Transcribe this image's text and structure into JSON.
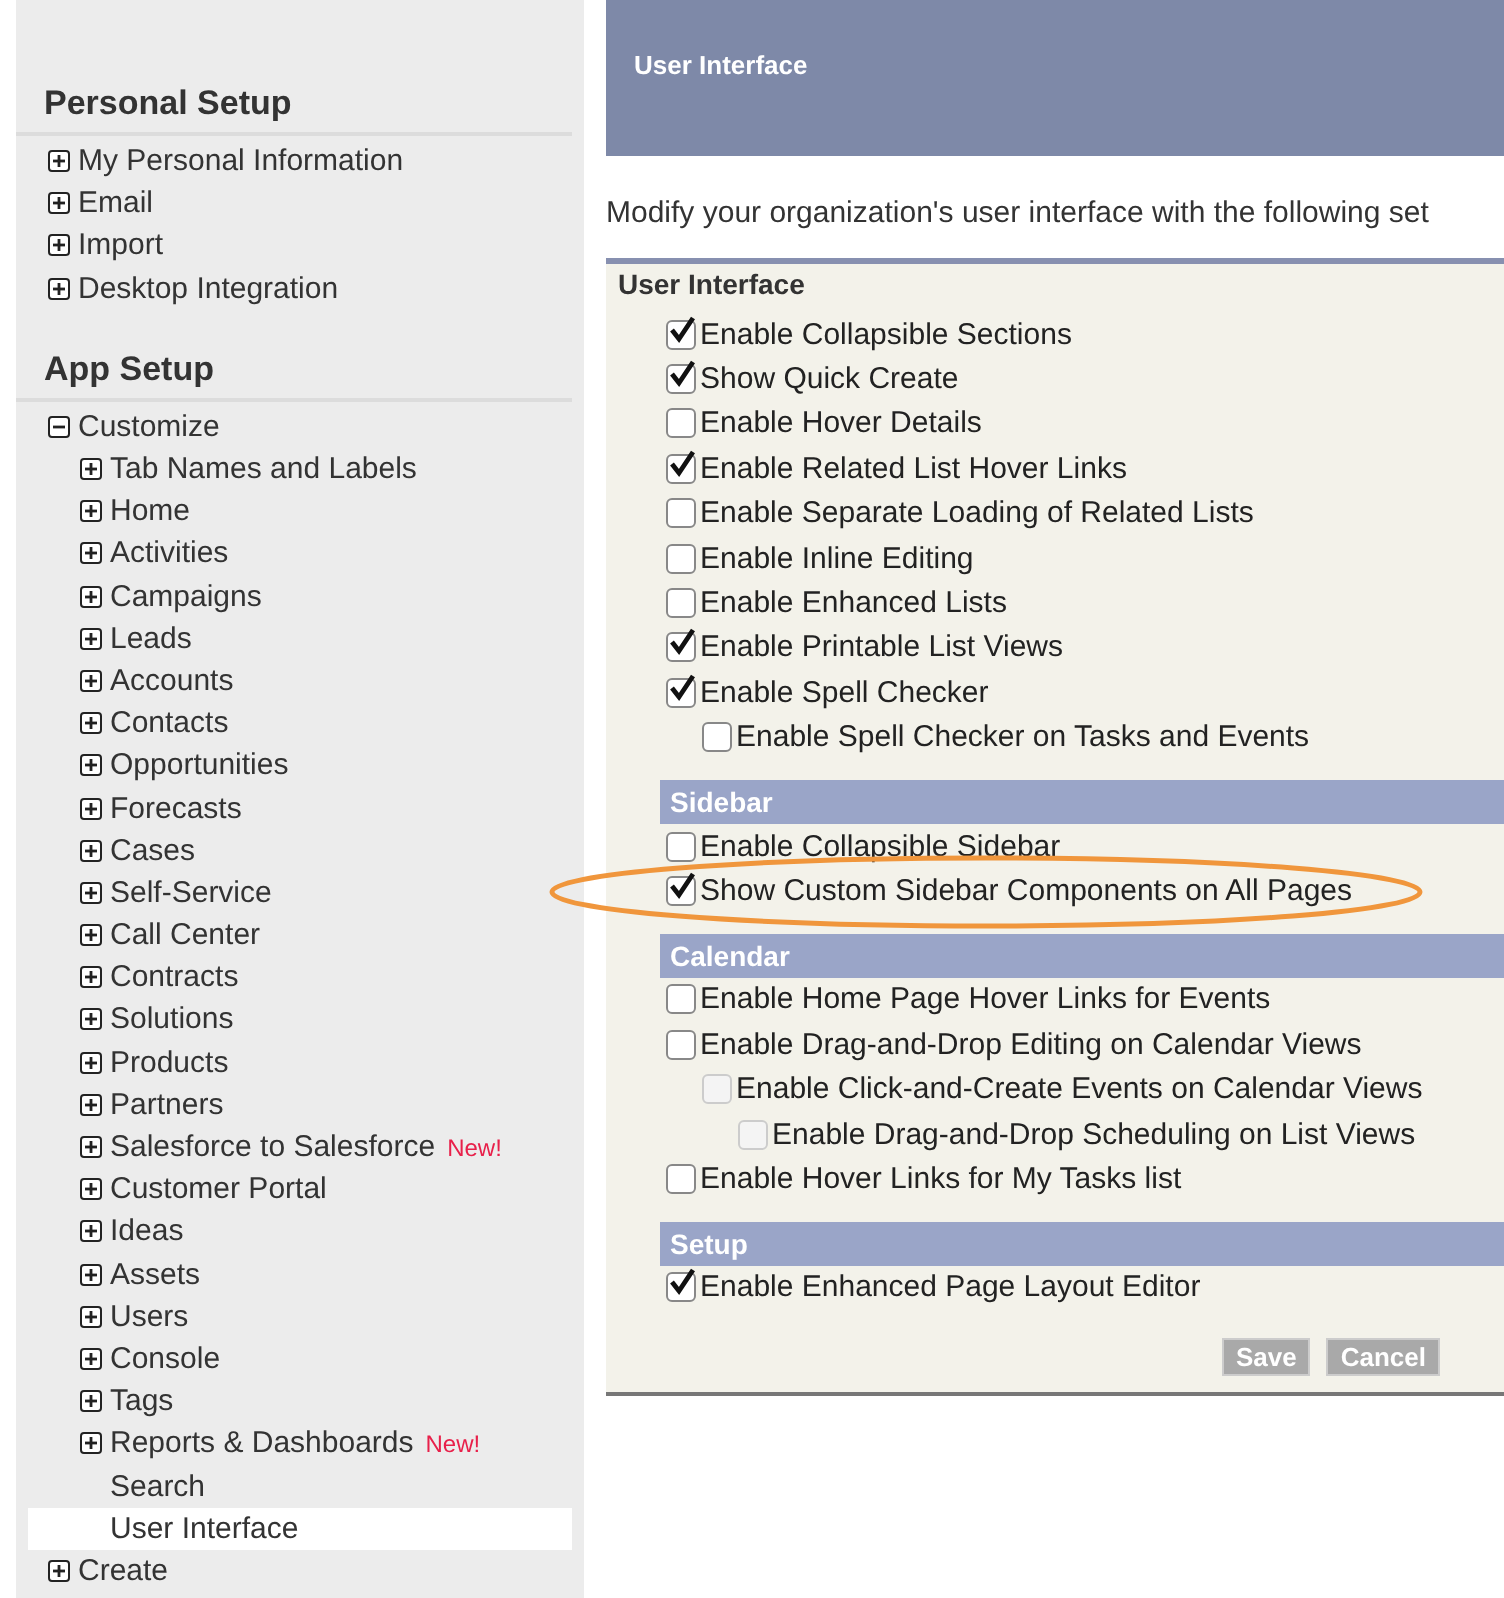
{
  "sidebar": {
    "sections": [
      {
        "title": "Personal Setup",
        "items": [
          {
            "label": "My Personal Information",
            "kind": "folder",
            "expanded": false,
            "selected": false
          },
          {
            "label": "Email",
            "kind": "folder",
            "expanded": false,
            "selected": false
          },
          {
            "label": "Import",
            "kind": "folder",
            "expanded": false,
            "selected": false
          },
          {
            "label": "Desktop Integration",
            "kind": "folder",
            "expanded": false,
            "selected": false
          }
        ]
      },
      {
        "title": "App Setup",
        "items": [
          {
            "label": "Customize",
            "kind": "folder",
            "expanded": true,
            "selected": false,
            "children": [
              {
                "label": "Tab Names and Labels",
                "kind": "folder",
                "expanded": false,
                "selected": false
              },
              {
                "label": "Home",
                "kind": "folder",
                "expanded": false,
                "selected": false
              },
              {
                "label": "Activities",
                "kind": "folder",
                "expanded": false,
                "selected": false
              },
              {
                "label": "Campaigns",
                "kind": "folder",
                "expanded": false,
                "selected": false
              },
              {
                "label": "Leads",
                "kind": "folder",
                "expanded": false,
                "selected": false
              },
              {
                "label": "Accounts",
                "kind": "folder",
                "expanded": false,
                "selected": false
              },
              {
                "label": "Contacts",
                "kind": "folder",
                "expanded": false,
                "selected": false
              },
              {
                "label": "Opportunities",
                "kind": "folder",
                "expanded": false,
                "selected": false
              },
              {
                "label": "Forecasts",
                "kind": "folder",
                "expanded": false,
                "selected": false
              },
              {
                "label": "Cases",
                "kind": "folder",
                "expanded": false,
                "selected": false
              },
              {
                "label": "Self-Service",
                "kind": "folder",
                "expanded": false,
                "selected": false
              },
              {
                "label": "Call Center",
                "kind": "folder",
                "expanded": false,
                "selected": false
              },
              {
                "label": "Contracts",
                "kind": "folder",
                "expanded": false,
                "selected": false
              },
              {
                "label": "Solutions",
                "kind": "folder",
                "expanded": false,
                "selected": false
              },
              {
                "label": "Products",
                "kind": "folder",
                "expanded": false,
                "selected": false
              },
              {
                "label": "Partners",
                "kind": "folder",
                "expanded": false,
                "selected": false
              },
              {
                "label": "Salesforce to Salesforce",
                "badge": "New!",
                "kind": "folder",
                "expanded": false,
                "selected": false
              },
              {
                "label": "Customer Portal",
                "kind": "folder",
                "expanded": false,
                "selected": false
              },
              {
                "label": "Ideas",
                "kind": "folder",
                "expanded": false,
                "selected": false
              },
              {
                "label": "Assets",
                "kind": "folder",
                "expanded": false,
                "selected": false
              },
              {
                "label": "Users",
                "kind": "folder",
                "expanded": false,
                "selected": false
              },
              {
                "label": "Console",
                "kind": "folder",
                "expanded": false,
                "selected": false
              },
              {
                "label": "Tags",
                "kind": "folder",
                "expanded": false,
                "selected": false
              },
              {
                "label": "Reports & Dashboards",
                "badge": "New!",
                "kind": "folder",
                "expanded": false,
                "selected": false
              },
              {
                "label": "Search",
                "kind": "page",
                "selected": false
              },
              {
                "label": "User Interface",
                "kind": "page",
                "selected": true
              }
            ]
          },
          {
            "label": "Create",
            "kind": "folder",
            "expanded": false,
            "selected": false
          }
        ]
      }
    ]
  },
  "page_header": {
    "title": "User Interface"
  },
  "intro": "Modify your organization's user interface with the following set",
  "form": {
    "sections": [
      {
        "title": "User Interface",
        "options": [
          {
            "label": "Enable Collapsible Sections",
            "checked": true,
            "disabled": false,
            "highlighted": false
          },
          {
            "label": "Show Quick Create",
            "checked": true,
            "disabled": false,
            "highlighted": false
          },
          {
            "label": "Enable Hover Details",
            "checked": false,
            "disabled": false,
            "highlighted": false
          },
          {
            "label": "Enable Related List Hover Links",
            "checked": true,
            "disabled": false,
            "highlighted": false
          },
          {
            "label": "Enable Separate Loading of Related Lists",
            "checked": false,
            "disabled": false,
            "highlighted": false
          },
          {
            "label": "Enable Inline Editing",
            "checked": false,
            "disabled": false,
            "highlighted": false
          },
          {
            "label": "Enable Enhanced Lists",
            "checked": false,
            "disabled": false,
            "highlighted": false
          },
          {
            "label": "Enable Printable List Views",
            "checked": true,
            "disabled": false,
            "highlighted": false
          },
          {
            "label": "Enable Spell Checker",
            "checked": true,
            "disabled": false,
            "highlighted": false,
            "children": [
              {
                "label": "Enable Spell Checker on Tasks and Events",
                "checked": false,
                "disabled": false,
                "highlighted": false
              }
            ]
          }
        ]
      },
      {
        "title": "Sidebar",
        "options": [
          {
            "label": "Enable Collapsible Sidebar",
            "checked": false,
            "disabled": false,
            "highlighted": false
          },
          {
            "label": "Show Custom Sidebar Components on All Pages",
            "checked": true,
            "disabled": false,
            "highlighted": true
          }
        ]
      },
      {
        "title": "Calendar",
        "options": [
          {
            "label": "Enable Home Page Hover Links for Events",
            "checked": false,
            "disabled": false,
            "highlighted": false
          },
          {
            "label": "Enable Drag-and-Drop Editing on Calendar Views",
            "checked": false,
            "disabled": false,
            "highlighted": false,
            "children": [
              {
                "label": "Enable Click-and-Create Events on Calendar Views",
                "checked": false,
                "disabled": true,
                "highlighted": false,
                "children": [
                  {
                    "label": "Enable Drag-and-Drop Scheduling on List Views",
                    "checked": false,
                    "disabled": true,
                    "highlighted": false
                  }
                ]
              }
            ]
          },
          {
            "label": "Enable Hover Links for My Tasks list",
            "checked": false,
            "disabled": false,
            "highlighted": false
          }
        ]
      },
      {
        "title": "Setup",
        "options": [
          {
            "label": "Enable Enhanced Page Layout Editor",
            "checked": true,
            "disabled": false,
            "highlighted": false
          }
        ]
      }
    ],
    "buttons": [
      "Save",
      "Cancel"
    ]
  }
}
